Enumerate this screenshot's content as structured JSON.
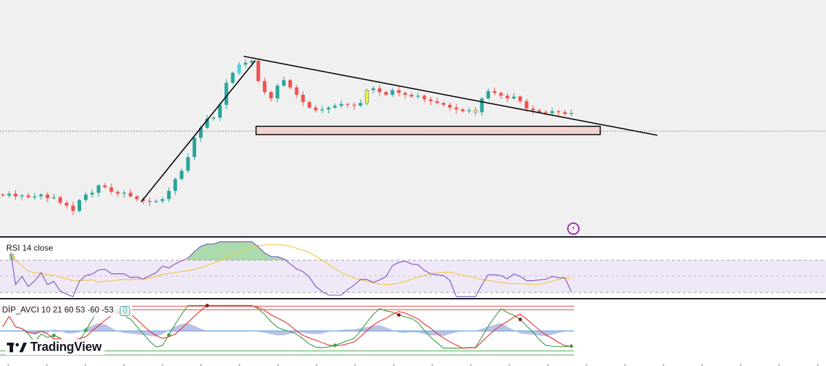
{
  "app": {
    "logo_text": "TradingView"
  },
  "panes": {
    "rsi": {
      "title": "RSI 14 close"
    },
    "dip": {
      "title": "DİP_AVCI 10 21 60 53 -60 -53",
      "settings_glyph": "{}"
    }
  },
  "icons": {
    "flash_icon": "⚡",
    "logo_icon": "tradingview-logo-icon"
  },
  "colors": {
    "up": "#26a69a",
    "down": "#ef5350",
    "highlight_candle": "#e8f53b",
    "highlight_candle_blue": "#4dd0e1",
    "trendline": "#000000",
    "support_box_fill": "#f8c9c9",
    "rsi_line": "#7e57c2",
    "rsi_ma": "#f5c542",
    "rsi_band": "#ede7f6",
    "dip_green": "#43a047",
    "dip_red": "#e53935",
    "dip_histogram": "#9fa8da"
  },
  "chart_data": [
    {
      "type": "candlestick",
      "title": "",
      "series_close": [
        15,
        15.2,
        14.9,
        15,
        14.8,
        14.9,
        15.1,
        14.7,
        14.8,
        14.2,
        13.9,
        13.3,
        14.5,
        15.1,
        15.3,
        16.1,
        15.9,
        15.4,
        15.2,
        15.3,
        14.9,
        14.6,
        14.4,
        14.3,
        14.4,
        14.6,
        15.5,
        16.8,
        17.7,
        19.2,
        21.3,
        22.4,
        23.4,
        23.5,
        24.9,
        27.3,
        28.4,
        29.3,
        29.5,
        29.7,
        27.5,
        26.3,
        25.6,
        27.0,
        27.6,
        26.8,
        26.0,
        25.2,
        24.6,
        24.3,
        24.4,
        24.6,
        24.8,
        25.0,
        24.9,
        24.8,
        25.1,
        26.5,
        26.7,
        26.3,
        26.0,
        26.5,
        26.2,
        26.0,
        25.8,
        25.9,
        25.5,
        25.3,
        25.1,
        24.9,
        24.6,
        24.4,
        24.2,
        24.3,
        24.1,
        25.6,
        26.4,
        26.2,
        25.9,
        25.6,
        25.8,
        25.3,
        24.5,
        24.3,
        24.1,
        24.0,
        24.2,
        24.1,
        23.9,
        24.0
      ]
    },
    {
      "type": "line",
      "title": "RSI 14 close"
    },
    {
      "type": "line",
      "title": "DİP_AVCI 10 21 60 53 -60 -53"
    }
  ]
}
